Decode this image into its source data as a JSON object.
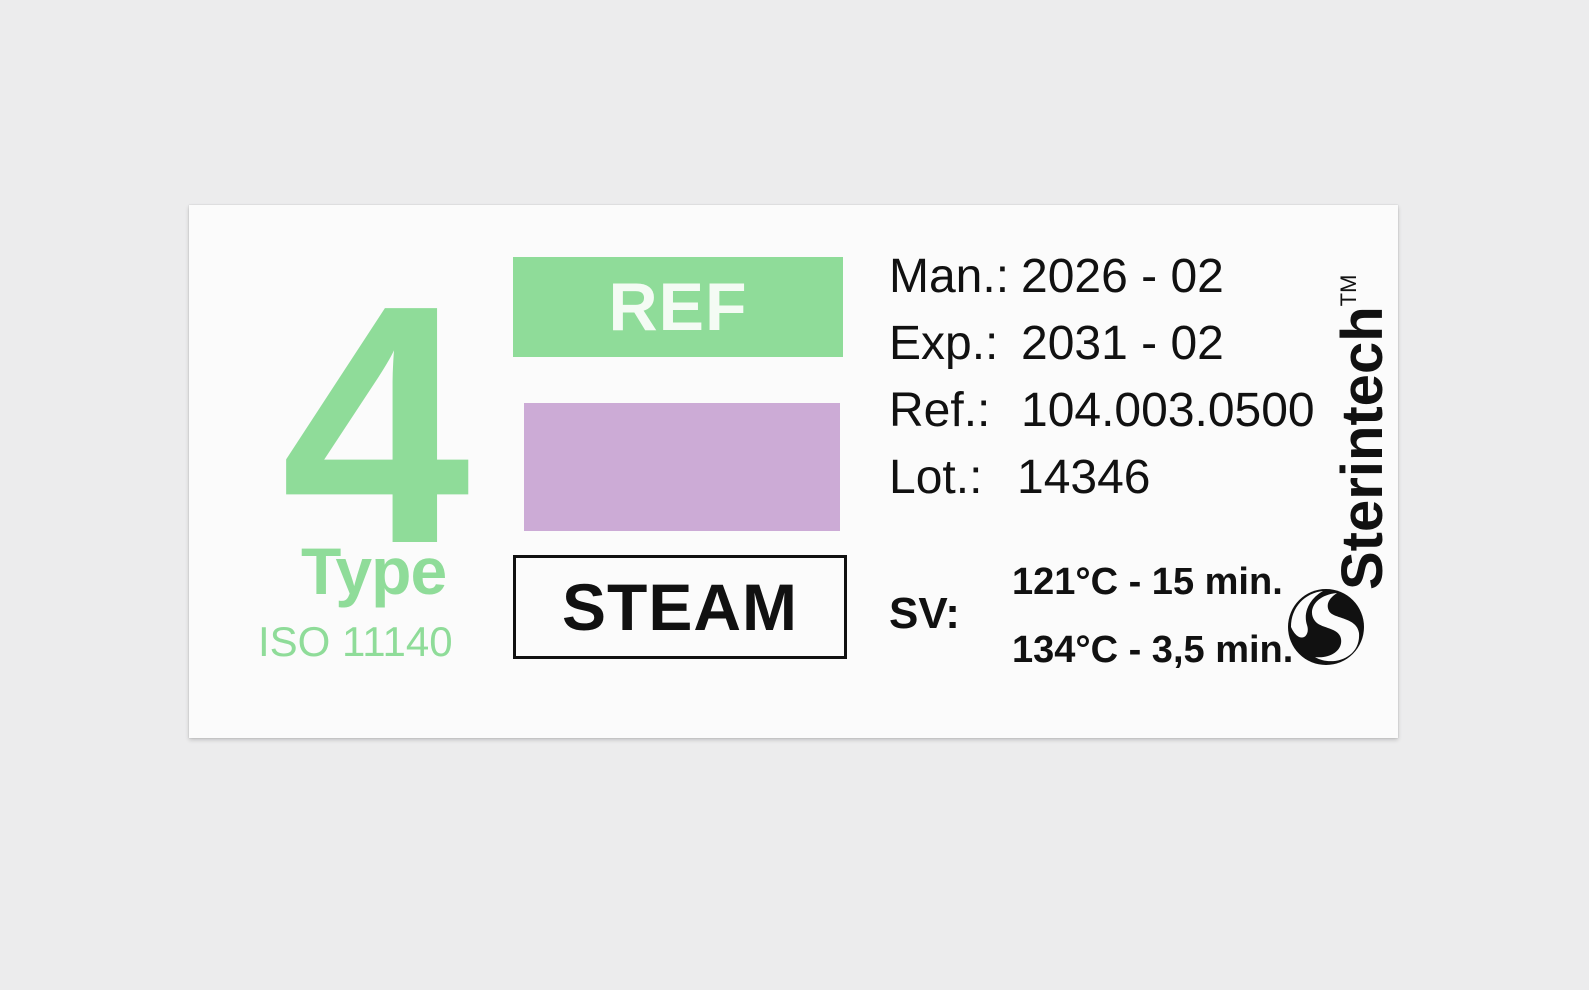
{
  "indicator": {
    "type_number": "4",
    "type_label": "Type",
    "standard": "ISO 11140"
  },
  "ref_label": "REF",
  "process": "STEAM",
  "info": [
    {
      "label": "Man.:",
      "value": "2026 - 02"
    },
    {
      "label": "Exp.:",
      "value": "2031 - 02"
    },
    {
      "label": "Ref.:",
      "value": "104.003.0500"
    },
    {
      "label": "Lot.:",
      "value": "14346"
    }
  ],
  "sv": {
    "label": "SV:",
    "values": [
      "121°C - 15 min.",
      "134°C - 3,5 min."
    ]
  },
  "brand": {
    "name": "Sterintech",
    "trademark": "TM",
    "logo_icon": "sterintech-swirl-icon"
  },
  "colors": {
    "green": "#8fdc99",
    "purple": "#ccabd6",
    "ink": "#111111"
  }
}
